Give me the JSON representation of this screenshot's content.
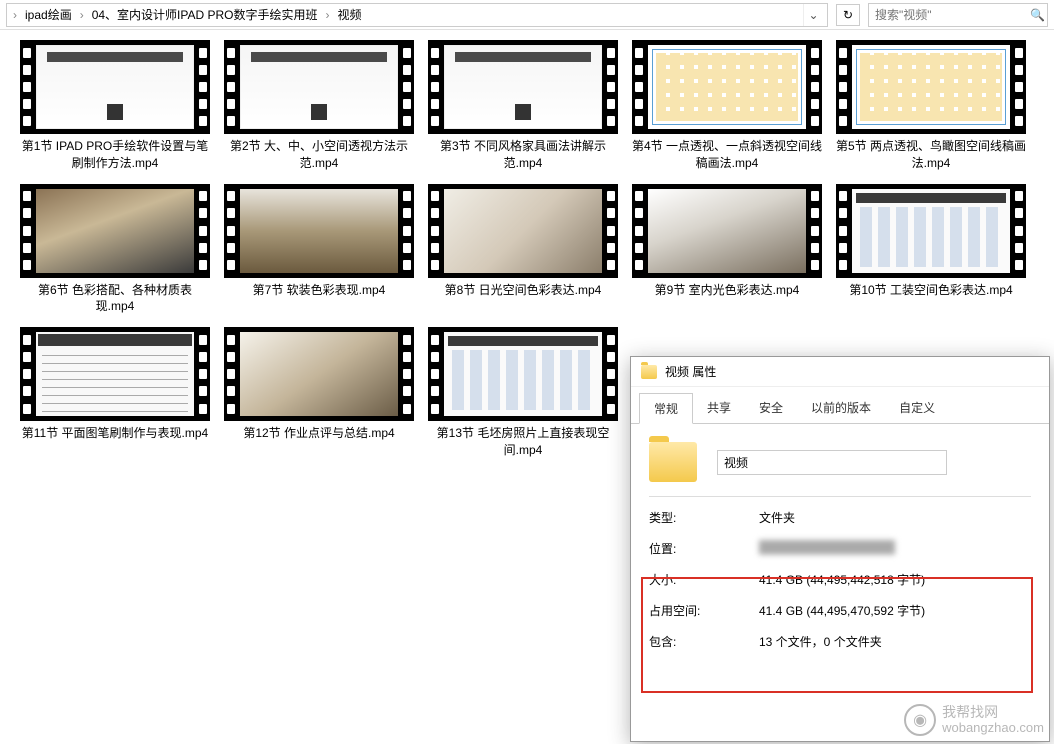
{
  "breadcrumb": [
    "ipad绘画",
    "04、室内设计师IPAD PRO数字手绘实用班",
    "视频"
  ],
  "search": {
    "placeholder": "搜索\"视频\""
  },
  "files": [
    {
      "name": "第1节 IPAD PRO手绘软件设置与笔刷制作方法.mp4",
      "thumb": "doc"
    },
    {
      "name": "第2节 大、中、小空间透视方法示范.mp4",
      "thumb": "doc"
    },
    {
      "name": "第3节 不同风格家具画法讲解示范.mp4",
      "thumb": "doc"
    },
    {
      "name": "第4节 一点透视、一点斜透视空间线稿画法.mp4",
      "thumb": "files"
    },
    {
      "name": "第5节 两点透视、鸟瞰图空间线稿画法.mp4",
      "thumb": "files"
    },
    {
      "name": "第6节 色彩搭配、各种材质表现.mp4",
      "thumb": "int1"
    },
    {
      "name": "第7节 软装色彩表现.mp4",
      "thumb": "int2"
    },
    {
      "name": "第8节 日光空间色彩表达.mp4",
      "thumb": "int3"
    },
    {
      "name": "第9节 室内光色彩表达.mp4",
      "thumb": "int4"
    },
    {
      "name": "第10节 工装空间色彩表达.mp4",
      "thumb": "icons"
    },
    {
      "name": "第11节 平面图笔刷制作与表现.mp4",
      "thumb": "sketch"
    },
    {
      "name": "第12节 作业点评与总结.mp4",
      "thumb": "room"
    },
    {
      "name": "第13节 毛坯房照片上直接表现空间.mp4",
      "thumb": "icons"
    }
  ],
  "properties": {
    "title": "视频 属性",
    "tabs": [
      "常规",
      "共享",
      "安全",
      "以前的版本",
      "自定义"
    ],
    "active_tab": 0,
    "name": "视频",
    "rows": {
      "type_label": "类型:",
      "type_value": "文件夹",
      "location_label": "位置:",
      "location_value": "",
      "size_label": "大小:",
      "size_value": "41.4 GB (44,495,442,518 字节)",
      "disk_label": "占用空间:",
      "disk_value": "41.4 GB (44,495,470,592 字节)",
      "contains_label": "包含:",
      "contains_value": "13 个文件，0 个文件夹"
    }
  },
  "watermark": {
    "cn": "我帮找网",
    "en": "wobangzhao.com"
  }
}
